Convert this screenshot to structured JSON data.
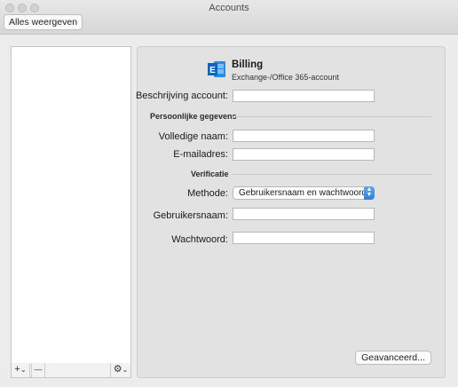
{
  "window": {
    "title": "Accounts"
  },
  "toolbar": {
    "show_all_label": "Alles weergeven"
  },
  "sidebar": {
    "add_label": "+",
    "caret": "⌄",
    "remove_label": "—",
    "gear_label": "⚙"
  },
  "account": {
    "name": "Billing",
    "type": "Exchange-/Office 365-account"
  },
  "form": {
    "description_label": "Beschrijving account:",
    "description_value": "",
    "personal_section": "Persoonlijke gegevens",
    "fullname_label": "Volledige naam:",
    "fullname_value": "",
    "email_label": "E-mailadres:",
    "email_value": "",
    "verification_section": "Verificatie",
    "method_label": "Methode:",
    "method_value": "Gebruikersnaam en wachtwoord",
    "username_label": "Gebruikersnaam:",
    "username_value": "",
    "password_label": "Wachtwoord:",
    "password_value": ""
  },
  "advanced_label": "Geavanceerd...",
  "colors": {
    "accent": "#2f7fde",
    "exchange_blue": "#0a64c2"
  }
}
